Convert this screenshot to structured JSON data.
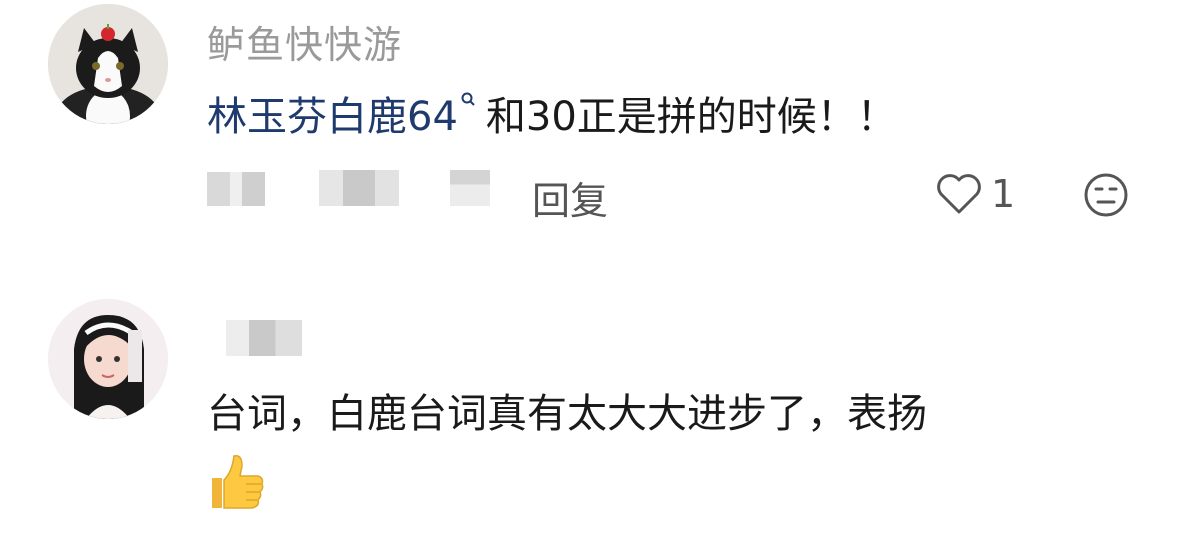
{
  "comments": [
    {
      "username": "鲈鱼快快游",
      "mention": "林玉芬白鹿64",
      "text": "和30正是拼的时候！！",
      "reply_label": "回复",
      "like_count": "1"
    },
    {
      "username": "",
      "text": "台词，白鹿台词真有太大大进步了，表扬",
      "emoji": "thumbs-up"
    }
  ]
}
